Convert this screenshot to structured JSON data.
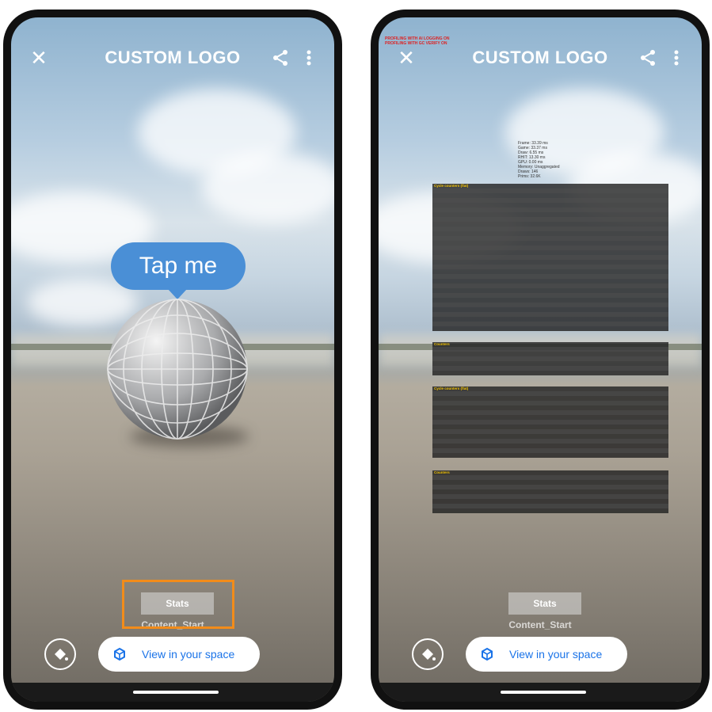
{
  "left_phone": {
    "title": "CUSTOM LOGO",
    "bubble_text": "Tap me",
    "stats_label": "Stats",
    "content_label": "Content_Start",
    "view_button_label": "View in your space"
  },
  "right_phone": {
    "title": "CUSTOM LOGO",
    "stats_label": "Stats",
    "content_label": "Content_Start",
    "view_button_label": "View in your space",
    "profiler": {
      "top_lines": [
        "PROFILING WITH AI LOGGING ON",
        "PROFILING WITH GC VERIFY ON"
      ],
      "summary": [
        "Frame: 33.39 ms",
        "Game: 33.37 ms",
        "Draw: 6.55 ms",
        "RHIT: 13.30 ms",
        "GPU: 0.00 ms",
        "Memory: Unaggregated",
        "Draws: 146",
        "Prims: 32.6K"
      ],
      "section1_title": "Cycle counters (flat)",
      "section2_title": "Counters",
      "section3_title": "Cycle counters (flat)",
      "section4_title": "Counters"
    }
  },
  "icons": {
    "close": "close-icon",
    "share": "share-icon",
    "menu": "more-vert-icon",
    "paint": "paint-bucket-icon",
    "ar": "ar-cube-icon"
  },
  "colors": {
    "highlight": "#f28c1a",
    "bubble": "#4a8fd6",
    "button_text": "#1a73e8"
  }
}
